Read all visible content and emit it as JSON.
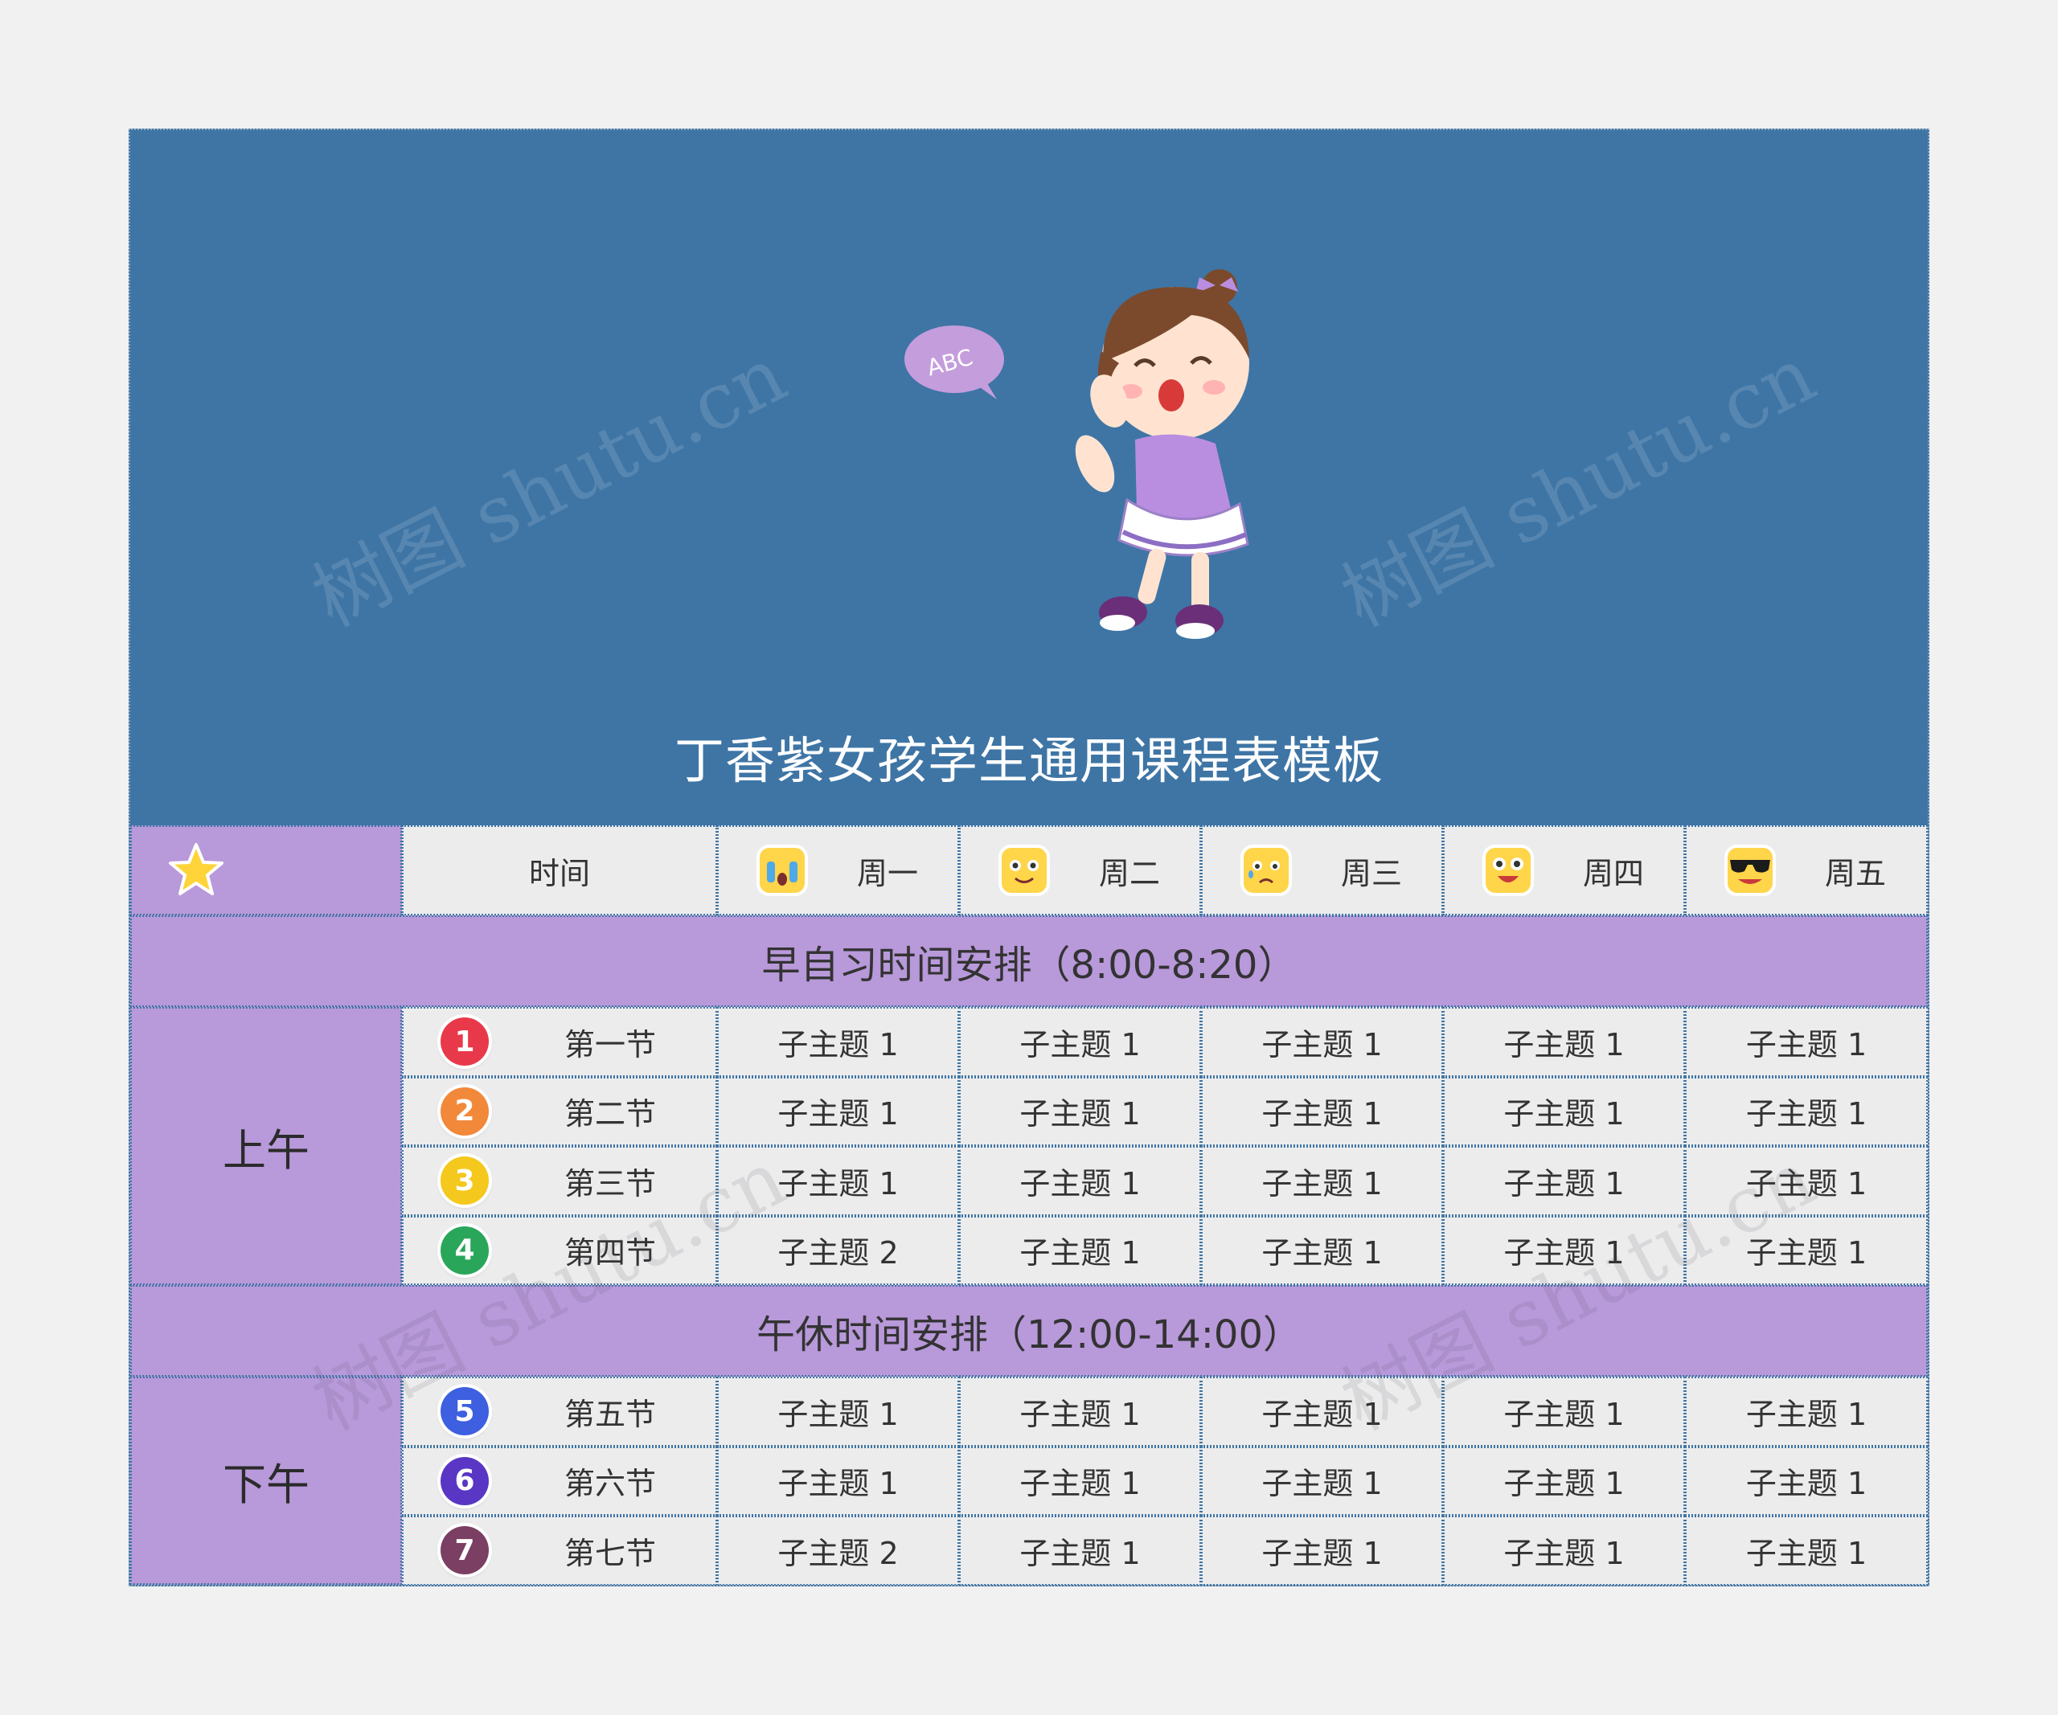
{
  "title": "丁香紫女孩学生通用课程表模板",
  "watermark": "树图 shutu.cn",
  "bubble_text": "ABC",
  "header": {
    "time_label": "时间",
    "days": [
      {
        "label": "周一",
        "icon": "crying-face-icon"
      },
      {
        "label": "周二",
        "icon": "smiling-face-icon"
      },
      {
        "label": "周三",
        "icon": "sad-face-icon"
      },
      {
        "label": "周四",
        "icon": "happy-face-icon"
      },
      {
        "label": "周五",
        "icon": "sunglasses-face-icon"
      }
    ]
  },
  "bands": {
    "morning": "早自习时间安排（8:00-8:20）",
    "noon": "午休时间安排（12:00-14:00）"
  },
  "periods": {
    "am": "上午",
    "pm": "下午"
  },
  "lessons": [
    {
      "num": "1",
      "label": "第一节",
      "color": "#e8394a",
      "cells": [
        "子主题 1",
        "子主题 1",
        "子主题 1",
        "子主题 1",
        "子主题 1"
      ]
    },
    {
      "num": "2",
      "label": "第二节",
      "color": "#f2883a",
      "cells": [
        "子主题 1",
        "子主题 1",
        "子主题 1",
        "子主题 1",
        "子主题 1"
      ]
    },
    {
      "num": "3",
      "label": "第三节",
      "color": "#f4c81c",
      "cells": [
        "子主题 1",
        "子主题 1",
        "子主题 1",
        "子主题 1",
        "子主题 1"
      ]
    },
    {
      "num": "4",
      "label": "第四节",
      "color": "#2aa65a",
      "cells": [
        "子主题 2",
        "子主题 1",
        "子主题 1",
        "子主题 1",
        "子主题 1"
      ]
    },
    {
      "num": "5",
      "label": "第五节",
      "color": "#3d5fe0",
      "cells": [
        "子主题 1",
        "子主题 1",
        "子主题 1",
        "子主题 1",
        "子主题 1"
      ]
    },
    {
      "num": "6",
      "label": "第六节",
      "color": "#5a36c4",
      "cells": [
        "子主题 1",
        "子主题 1",
        "子主题 1",
        "子主题 1",
        "子主题 1"
      ]
    },
    {
      "num": "7",
      "label": "第七节",
      "color": "#7a3f62",
      "cells": [
        "子主题 2",
        "子主题 1",
        "子主题 1",
        "子主题 1",
        "子主题 1"
      ]
    }
  ],
  "colors": {
    "banner": "#3e75a5",
    "purple": "#b899da",
    "cell": "#ececec"
  }
}
